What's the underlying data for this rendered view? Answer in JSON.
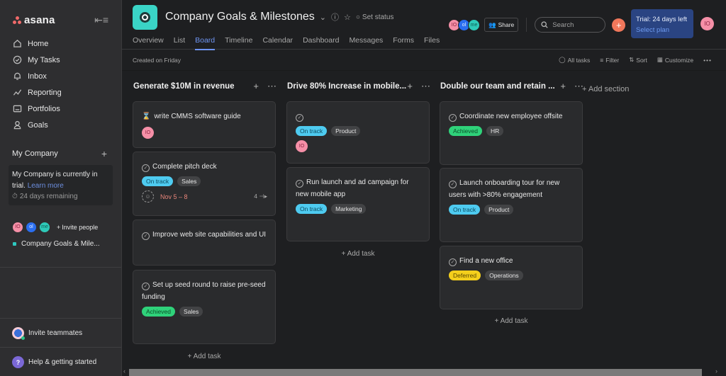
{
  "sidebar": {
    "brand": "asana",
    "nav": [
      {
        "label": "Home",
        "icon": "home-icon"
      },
      {
        "label": "My Tasks",
        "icon": "check-circle-icon"
      },
      {
        "label": "Inbox",
        "icon": "bell-icon"
      },
      {
        "label": "Reporting",
        "icon": "chart-line-icon"
      },
      {
        "label": "Portfolios",
        "icon": "folder-icon"
      },
      {
        "label": "Goals",
        "icon": "person-icon"
      }
    ],
    "team": {
      "name": "My Company",
      "trial_text": "My Company is currently in trial.",
      "learn_more": "Learn more",
      "remaining": "24 days remaining"
    },
    "members": [
      "IO",
      "ol",
      "me"
    ],
    "invite_people": "Invite people",
    "project": "Company Goals & Mile...",
    "invite_teammates": "Invite teammates",
    "help": "Help & getting started"
  },
  "header": {
    "title": "Company Goals & Milestones",
    "set_status": "Set status",
    "tabs": [
      "Overview",
      "List",
      "Board",
      "Timeline",
      "Calendar",
      "Dashboard",
      "Messages",
      "Forms",
      "Files"
    ],
    "active_tab": "Board",
    "members": [
      "IO",
      "ol",
      "me"
    ],
    "share": "Share",
    "search_placeholder": "Search",
    "trial": {
      "title": "Trial: 24 days left",
      "cta": "Select plan"
    },
    "user_initials": "IO"
  },
  "subbar": {
    "created": "Created on Friday",
    "tools": [
      "All tasks",
      "Filter",
      "Sort",
      "Customize"
    ]
  },
  "board": {
    "columns": [
      {
        "title": "Generate $10M in revenue",
        "cards": [
          {
            "title": "write CMMS software guide",
            "icon": "hourglass",
            "assignee": "IO"
          },
          {
            "title": "Complete pitch deck",
            "status": "On track",
            "label": "Sales",
            "due": "Nov 5 – 8",
            "subtasks": "4"
          },
          {
            "title": "Improve web site capabilities and UI"
          },
          {
            "title": "Set up seed round to raise pre-seed funding",
            "status": "Achieved",
            "label": "Sales"
          }
        ],
        "add_task": "Add task"
      },
      {
        "title": "Drive 80% Increase in mobile...",
        "cards": [
          {
            "title": "",
            "status": "On track",
            "label": "Product",
            "assignee": "IO"
          },
          {
            "title": "Run launch and ad campaign for new mobile app",
            "status": "On track",
            "label": "Marketing"
          }
        ],
        "add_task": "Add task"
      },
      {
        "title": "Double our team and retain ...",
        "cards": [
          {
            "title": "Coordinate new employee offsite",
            "status": "Achieved",
            "label": "HR"
          },
          {
            "title": "Launch onboarding tour for new users with >80% engagement",
            "status": "On track",
            "label": "Product"
          },
          {
            "title": "Find a new office",
            "status": "Deferred",
            "label": "Operations"
          }
        ],
        "add_task": "Add task"
      }
    ],
    "add_section": "Add section"
  },
  "status_colors": {
    "On track": {
      "bg": "#4ecbf0",
      "fg": "#0d4a5e"
    },
    "Achieved": {
      "bg": "#2fd27a",
      "fg": "#0b4d28"
    },
    "Deferred": {
      "bg": "#f4cf1c",
      "fg": "#5a4700"
    }
  }
}
